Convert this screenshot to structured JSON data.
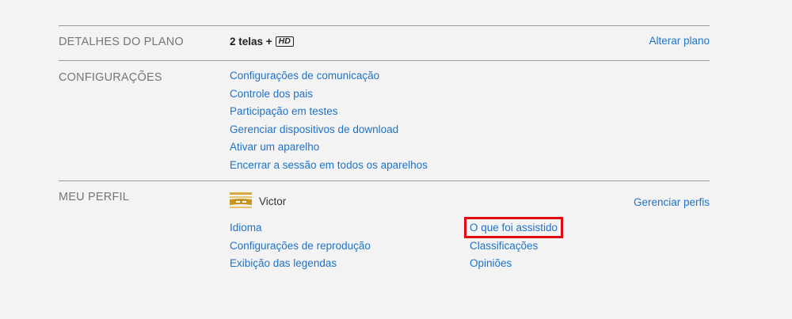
{
  "plan": {
    "section_title": "DETALHES DO PLANO",
    "plan_text": "2 telas +",
    "hd_badge": "HD",
    "change_plan_link": "Alterar plano"
  },
  "settings": {
    "section_title": "CONFIGURAÇÕES",
    "links": [
      "Configurações de comunicação",
      "Controle dos pais",
      "Participação em testes",
      "Gerenciar dispositivos de download",
      "Ativar um aparelho",
      "Encerrar a sessão em todos os aparelhos"
    ]
  },
  "profile": {
    "section_title": "MEU PERFIL",
    "name": "Victor",
    "manage_profiles_link": "Gerenciar perfis",
    "left_links": [
      "Idioma",
      "Configurações de reprodução",
      "Exibição das legendas"
    ],
    "right_links": [
      "O que foi assistido",
      "Classificações",
      "Opiniões"
    ],
    "highlighted_link": "O que foi assistido",
    "highlight_color": "#e50914"
  },
  "colors": {
    "link": "#1f72c7",
    "background": "#f3f3f3",
    "section_title": "#757575"
  }
}
